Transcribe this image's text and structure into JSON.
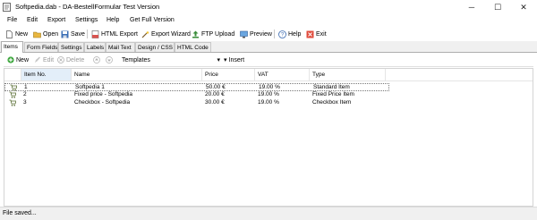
{
  "window": {
    "title": "Softpedia.dab  -  DA-BestellFormular  Test Version",
    "controls": {
      "minimize": "─",
      "maximize": "☐",
      "close": "✕"
    }
  },
  "menu": [
    "File",
    "Edit",
    "Export",
    "Settings",
    "Help",
    "Get Full Version"
  ],
  "toolbar": {
    "new": "New",
    "open": "Open",
    "save": "Save",
    "html_export": "HTML Export",
    "export_wizard": "Export Wizard",
    "ftp_upload": "FTP Upload",
    "preview": "Preview",
    "help": "Help",
    "exit": "Exit"
  },
  "tabs": [
    "Items",
    "Form Fields",
    "Settings",
    "Labels",
    "Mail Text",
    "Design / CSS",
    "HTML Code"
  ],
  "subtoolbar": {
    "new": "New",
    "edit": "Edit",
    "delete": "Delete",
    "templates": "Templates",
    "insert": "Insert"
  },
  "columns": [
    "Item No.",
    "Name",
    "Price",
    "VAT",
    "Type"
  ],
  "rows": [
    {
      "no": "1",
      "name": "Softpedia 1",
      "price": "50.00 €",
      "vat": "19.00 %",
      "type": "Standard Item"
    },
    {
      "no": "2",
      "name": "Fixed price - Softpedia",
      "price": "20.00 €",
      "vat": "19.00 %",
      "type": "Fixed Price Item"
    },
    {
      "no": "3",
      "name": "Checkbox - Softpedia",
      "price": "30.00 €",
      "vat": "19.00 %",
      "type": "Checkbox Item"
    }
  ],
  "status": "File saved..."
}
